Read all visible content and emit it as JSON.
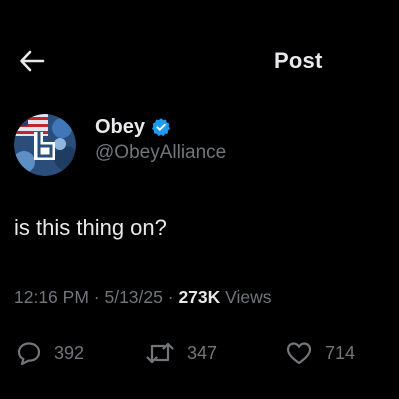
{
  "header": {
    "title": "Post",
    "back_icon": "arrow-left-icon"
  },
  "author": {
    "display_name": "Obey",
    "handle": "@ObeyAlliance",
    "verified_icon": "verified-badge-icon",
    "verified_color": "#1d9bf0",
    "avatar_icon": "obey-logo-avatar"
  },
  "post": {
    "text": "is this thing on?"
  },
  "meta": {
    "time": "12:16 PM",
    "separator_1": "·",
    "date": "5/13/25",
    "separator_2": "·",
    "views_count": "273K",
    "views_label": "Views"
  },
  "actions": {
    "reply": {
      "icon": "reply-icon",
      "count": "392"
    },
    "repost": {
      "icon": "repost-icon",
      "count": "347"
    },
    "like": {
      "icon": "heart-icon",
      "count": "714"
    }
  },
  "colors": {
    "background": "#000000",
    "text_primary": "#e7e9ea",
    "text_secondary": "#71767b",
    "accent": "#1d9bf0"
  }
}
